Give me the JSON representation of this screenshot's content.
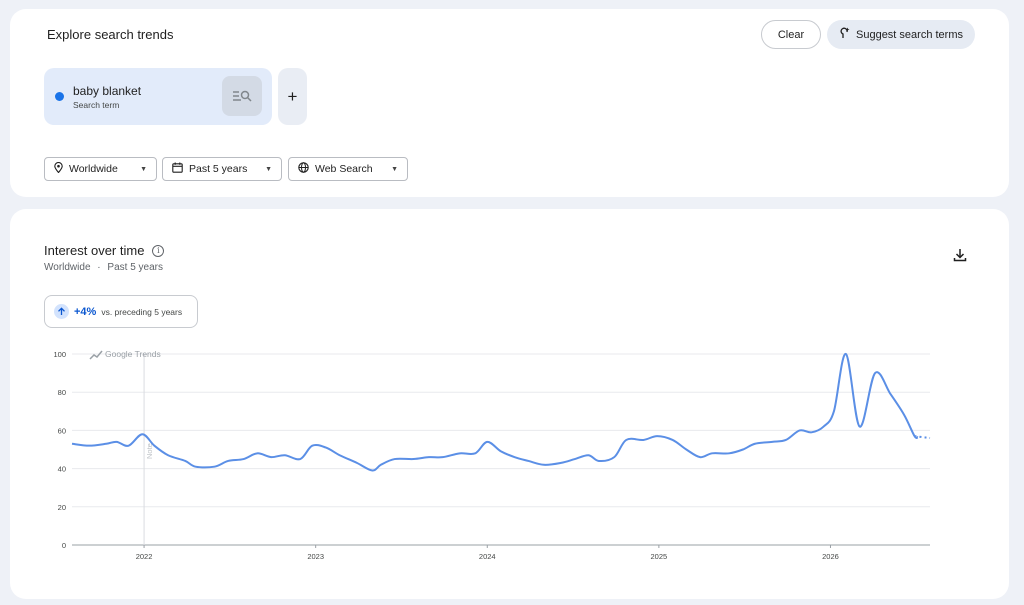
{
  "header": {
    "title": "Explore search trends",
    "clear_label": "Clear",
    "suggest_label": "Suggest search terms"
  },
  "term": {
    "name": "baby blanket",
    "type": "Search term",
    "color": "#1a73e8"
  },
  "add_term_label": "+",
  "filters": {
    "geo": "Worldwide",
    "time": "Past 5 years",
    "property": "Web Search"
  },
  "section": {
    "title": "Interest over time",
    "info_icon_text": "i",
    "subtitle_geo": "Worldwide",
    "subtitle_sep": "·",
    "subtitle_time": "Past 5 years"
  },
  "change": {
    "value": "+4%",
    "label": "vs. preceding 5 years"
  },
  "watermark": "Google Trends",
  "marker_note": "Note",
  "chart_data": {
    "type": "line",
    "title": "",
    "xlabel": "",
    "ylabel": "",
    "ylim": [
      0,
      100
    ],
    "yticks": [
      0,
      20,
      40,
      60,
      80,
      100
    ],
    "xticks": [
      "2022",
      "2023",
      "2024",
      "2025",
      "2026"
    ],
    "xtick_positions": [
      2022.0,
      2023.0,
      2024.0,
      2025.0,
      2026.0
    ],
    "xlim": [
      2021.58,
      2026.58
    ],
    "grid": true,
    "legend": "none",
    "color": "#5b8fe6",
    "marker_x": 2022.0,
    "series": [
      {
        "values": [
          [
            2021.58,
            53
          ],
          [
            2021.68,
            52
          ],
          [
            2021.78,
            53
          ],
          [
            2021.84,
            54
          ],
          [
            2021.91,
            52
          ],
          [
            2021.99,
            58
          ],
          [
            2022.06,
            52
          ],
          [
            2022.14,
            47
          ],
          [
            2022.24,
            44
          ],
          [
            2022.3,
            41
          ],
          [
            2022.41,
            41
          ],
          [
            2022.49,
            44
          ],
          [
            2022.58,
            45
          ],
          [
            2022.66,
            48
          ],
          [
            2022.74,
            46
          ],
          [
            2022.82,
            47
          ],
          [
            2022.91,
            45
          ],
          [
            2022.98,
            52
          ],
          [
            2023.06,
            51
          ],
          [
            2023.14,
            47
          ],
          [
            2023.24,
            43
          ],
          [
            2023.33,
            39
          ],
          [
            2023.38,
            42
          ],
          [
            2023.46,
            45
          ],
          [
            2023.57,
            45
          ],
          [
            2023.66,
            46
          ],
          [
            2023.74,
            46
          ],
          [
            2023.84,
            48
          ],
          [
            2023.93,
            48
          ],
          [
            2024.0,
            54
          ],
          [
            2024.08,
            49
          ],
          [
            2024.16,
            46
          ],
          [
            2024.24,
            44
          ],
          [
            2024.33,
            42
          ],
          [
            2024.43,
            43
          ],
          [
            2024.51,
            45
          ],
          [
            2024.59,
            47
          ],
          [
            2024.65,
            44
          ],
          [
            2024.74,
            46
          ],
          [
            2024.81,
            55
          ],
          [
            2024.91,
            55
          ],
          [
            2024.99,
            57
          ],
          [
            2025.08,
            55
          ],
          [
            2025.16,
            50
          ],
          [
            2025.24,
            46
          ],
          [
            2025.31,
            48
          ],
          [
            2025.41,
            48
          ],
          [
            2025.49,
            50
          ],
          [
            2025.56,
            53
          ],
          [
            2025.66,
            54
          ],
          [
            2025.74,
            55
          ],
          [
            2025.82,
            60
          ],
          [
            2025.89,
            59
          ],
          [
            2025.96,
            62
          ],
          [
            2026.02,
            70
          ],
          [
            2026.09,
            100
          ],
          [
            2026.17,
            62
          ],
          [
            2026.26,
            90
          ],
          [
            2026.35,
            79
          ],
          [
            2026.43,
            68
          ],
          [
            2026.49,
            57
          ],
          [
            2026.51,
            56.5
          ]
        ],
        "partial_from": 2026.49,
        "partial_values": [
          [
            2026.49,
            57
          ],
          [
            2026.58,
            56
          ]
        ]
      }
    ]
  }
}
